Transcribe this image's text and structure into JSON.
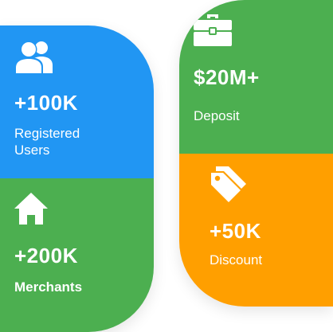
{
  "colors": {
    "blue": "#2196F3",
    "green": "#4CAF50",
    "orange": "#FF9F00",
    "text": "#FFFFFF"
  },
  "stats": {
    "registered_users": {
      "icon": "users-icon",
      "value": "+100K",
      "label": "Registered Users"
    },
    "merchants": {
      "icon": "home-icon",
      "value": "+200K",
      "label": "Merchants"
    },
    "deposit": {
      "icon": "briefcase-icon",
      "value": "$20M+",
      "label": "Deposit"
    },
    "discount": {
      "icon": "price-tag-icon",
      "value": "+50K",
      "label": "Discount"
    }
  }
}
